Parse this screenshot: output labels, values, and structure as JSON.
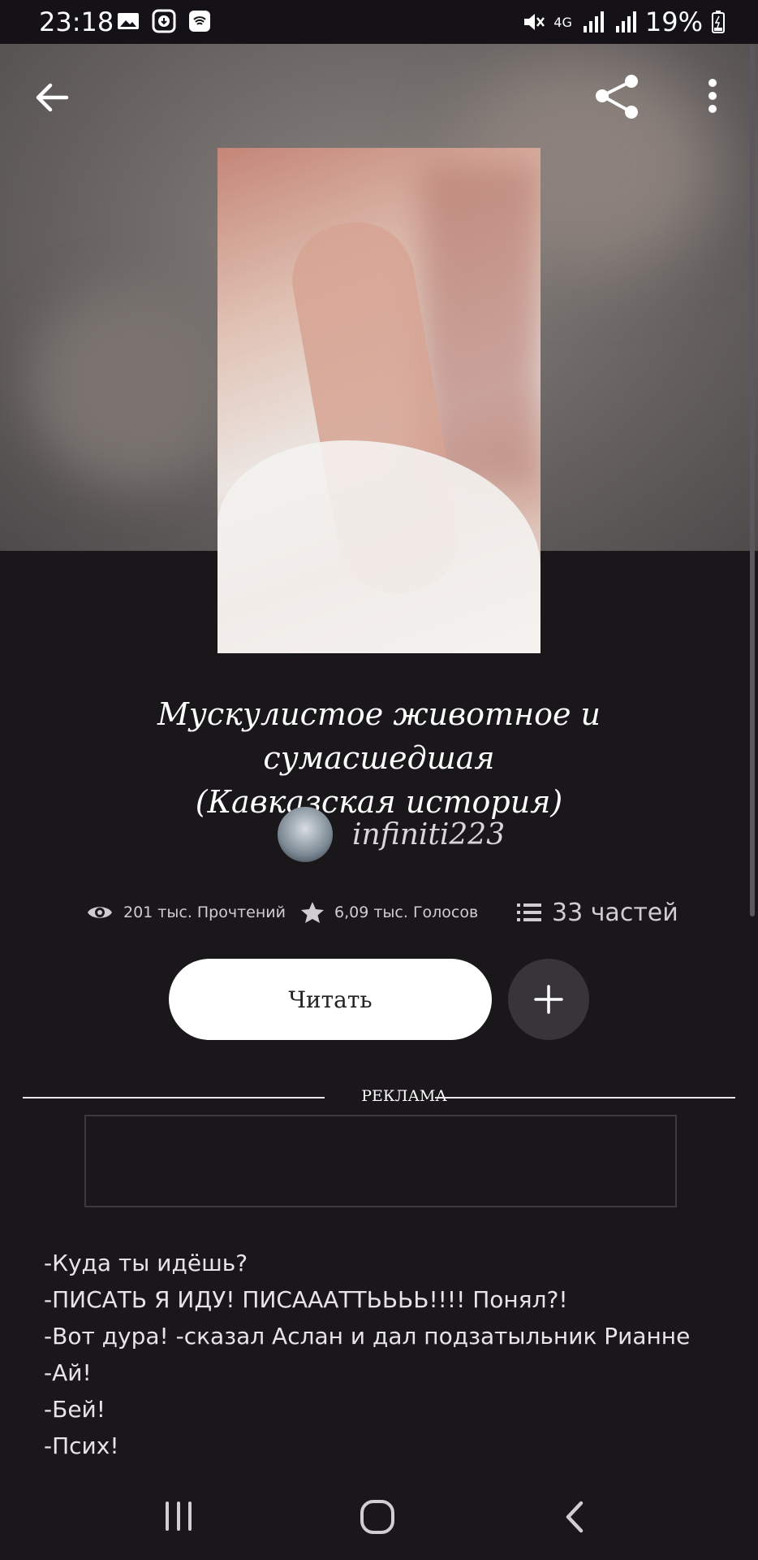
{
  "status_bar": {
    "time": "23:18",
    "network": "4G",
    "battery": "19%"
  },
  "book": {
    "title_line1": "Мускулистое животное и сумасшедшая",
    "title_line2": "(Кавказская история)",
    "author": "infiniti223",
    "reads": "201 тыс. Прочтений",
    "votes": "6,09 тыс. Голосов",
    "parts": "33 частей"
  },
  "actions": {
    "read_label": "Читать"
  },
  "ad": {
    "label": "РЕКЛАМА"
  },
  "story_lines": [
    "-Куда ты идёшь?",
    "-ПИСАТЬ Я ИДУ! ПИСАААТТЬЬЬЬ!!!! Понял?!",
    "-Вот дура! -сказал Аслан и дал подзатыльник Рианне",
    "-Ай!",
    "-Бей!",
    "-Псих!"
  ],
  "icons": [
    "back-icon",
    "share-icon",
    "more-icon",
    "eye-icon",
    "star-icon",
    "list-icon",
    "plus-icon",
    "recent-apps-icon",
    "home-icon",
    "nav-back-icon"
  ]
}
